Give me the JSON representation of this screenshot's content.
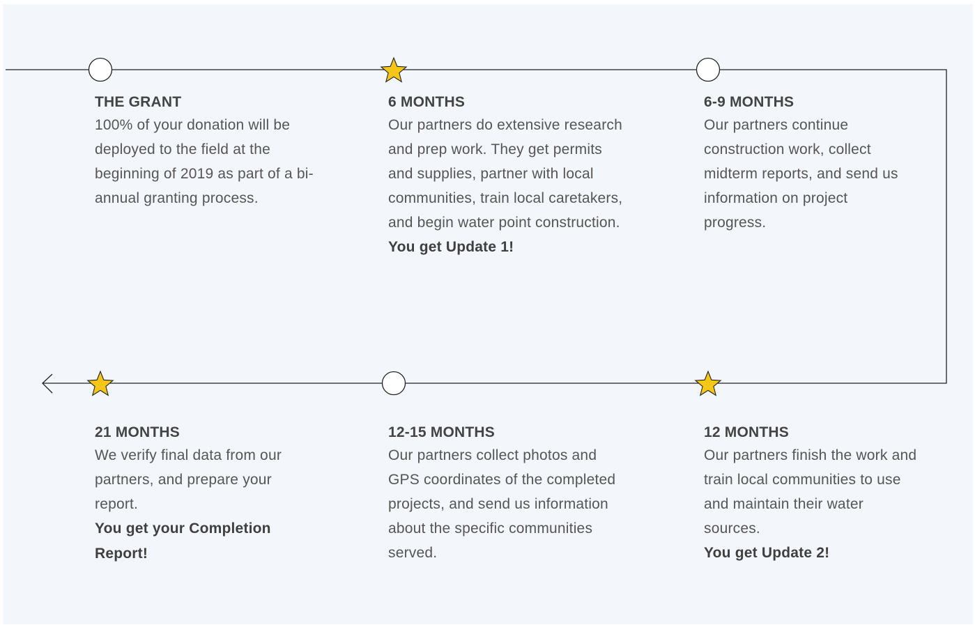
{
  "colors": {
    "background": "#f3f6fb",
    "line": "#222222",
    "star": "#f5c518",
    "node_fill": "#ffffff"
  },
  "steps": [
    {
      "marker": "circle",
      "title": "THE GRANT",
      "body": "100% of your donation will be deployed to the field at the beginning of 2019 as part of a bi-annual granting process.",
      "callout": ""
    },
    {
      "marker": "star",
      "title": "6 MONTHS",
      "body": "Our partners do extensive research and prep work. They get permits and supplies, partner with local communities, train local caretakers, and begin water point construction.",
      "callout": "You get Update 1!"
    },
    {
      "marker": "circle",
      "title": "6-9 MONTHS",
      "body": "Our partners continue construction work, collect midterm reports, and send us information on project progress.",
      "callout": ""
    },
    {
      "marker": "star",
      "title": "12 MONTHS",
      "body": "Our partners finish the work and train local communities to use and maintain their water sources.",
      "callout": "You get Update 2!"
    },
    {
      "marker": "circle",
      "title": "12-15 MONTHS",
      "body": "Our partners collect photos and GPS coordinates of the completed projects, and send us information about the specific communities served.",
      "callout": ""
    },
    {
      "marker": "star",
      "title": "21 MONTHS",
      "body": "We verify final data from our partners, and prepare your report.",
      "callout": "You get your Completion Report!"
    }
  ]
}
